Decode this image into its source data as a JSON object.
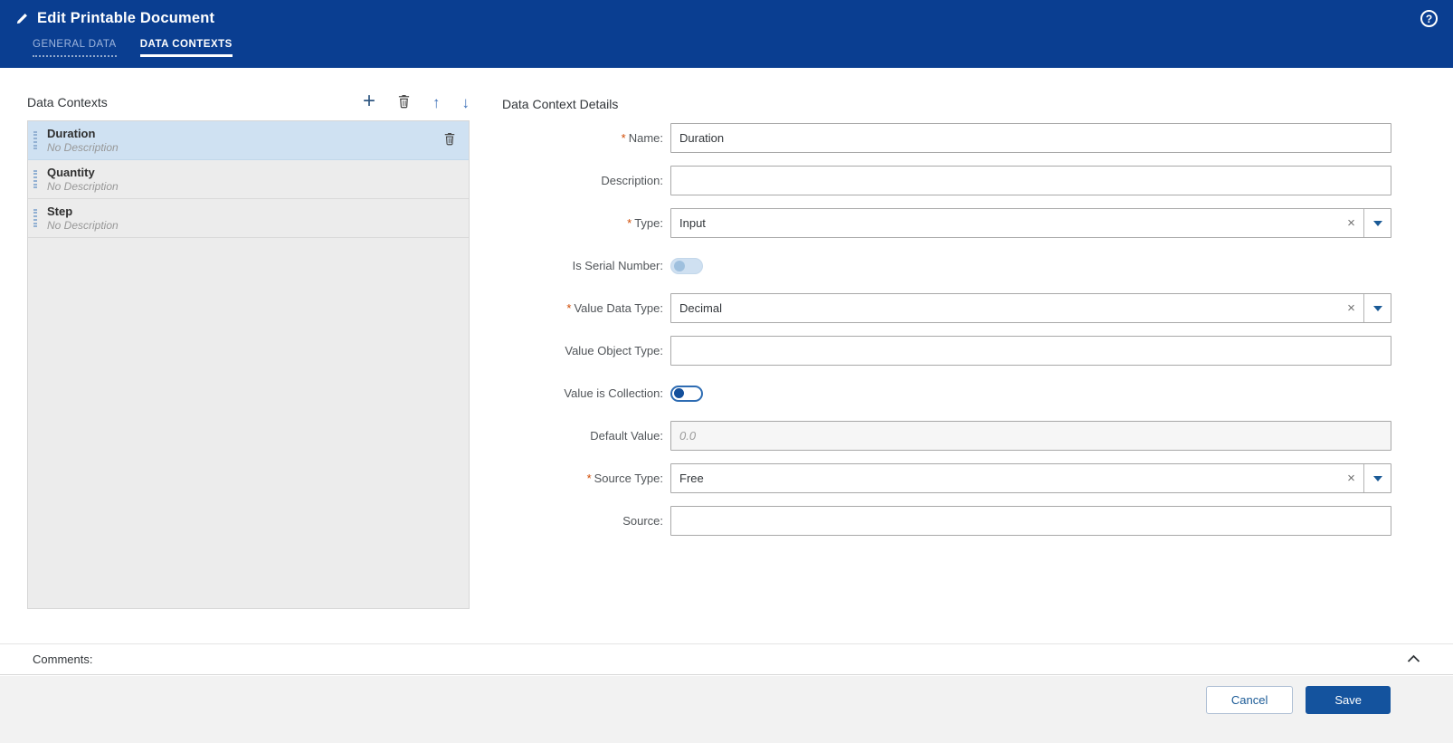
{
  "header": {
    "title": "Edit Printable Document",
    "tabs": [
      {
        "label": "GENERAL DATA",
        "active": false
      },
      {
        "label": "DATA CONTEXTS",
        "active": true
      }
    ]
  },
  "icons": {
    "help": "?",
    "add": "+",
    "move_up": "↑",
    "move_down": "↓",
    "clear": "×",
    "required_marker": "*",
    "edit": "pencil-icon",
    "delete": "trash-icon",
    "collapse": "chevron-up-icon",
    "dropdown": "chevron-down-icon"
  },
  "left_panel": {
    "title": "Data Contexts",
    "items": [
      {
        "name": "Duration",
        "description": "No Description",
        "selected": true
      },
      {
        "name": "Quantity",
        "description": "No Description",
        "selected": false
      },
      {
        "name": "Step",
        "description": "No Description",
        "selected": false
      }
    ]
  },
  "details": {
    "title": "Data Context Details",
    "fields": {
      "name": {
        "label": "Name:",
        "required": true,
        "value": "Duration"
      },
      "description": {
        "label": "Description:",
        "required": false,
        "value": ""
      },
      "type": {
        "label": "Type:",
        "required": true,
        "value": "Input"
      },
      "is_serial_number": {
        "label": "Is Serial Number:",
        "required": false,
        "state": "off",
        "enabled": false
      },
      "value_data_type": {
        "label": "Value Data Type:",
        "required": true,
        "value": "Decimal"
      },
      "value_object_type": {
        "label": "Value Object Type:",
        "required": false,
        "value": ""
      },
      "value_is_collection": {
        "label": "Value is Collection:",
        "required": false,
        "state": "off",
        "enabled": true
      },
      "default_value": {
        "label": "Default Value:",
        "required": false,
        "value": "",
        "placeholder": "0.0"
      },
      "source_type": {
        "label": "Source Type:",
        "required": true,
        "value": "Free"
      },
      "source": {
        "label": "Source:",
        "required": false,
        "value": ""
      }
    }
  },
  "comments": {
    "label": "Comments:"
  },
  "footer": {
    "cancel_label": "Cancel",
    "save_label": "Save"
  },
  "colors": {
    "header_background": "#0a3e91",
    "active_tab_underline": "#ffffff",
    "inactive_tab_text": "#9fb6de",
    "selected_item_background": "#cfe1f2",
    "required_asterisk": "#d04a02",
    "primary_button": "#14539e",
    "link_blue": "#1a5a96",
    "dropdown_arrow": "#1a5a96"
  }
}
